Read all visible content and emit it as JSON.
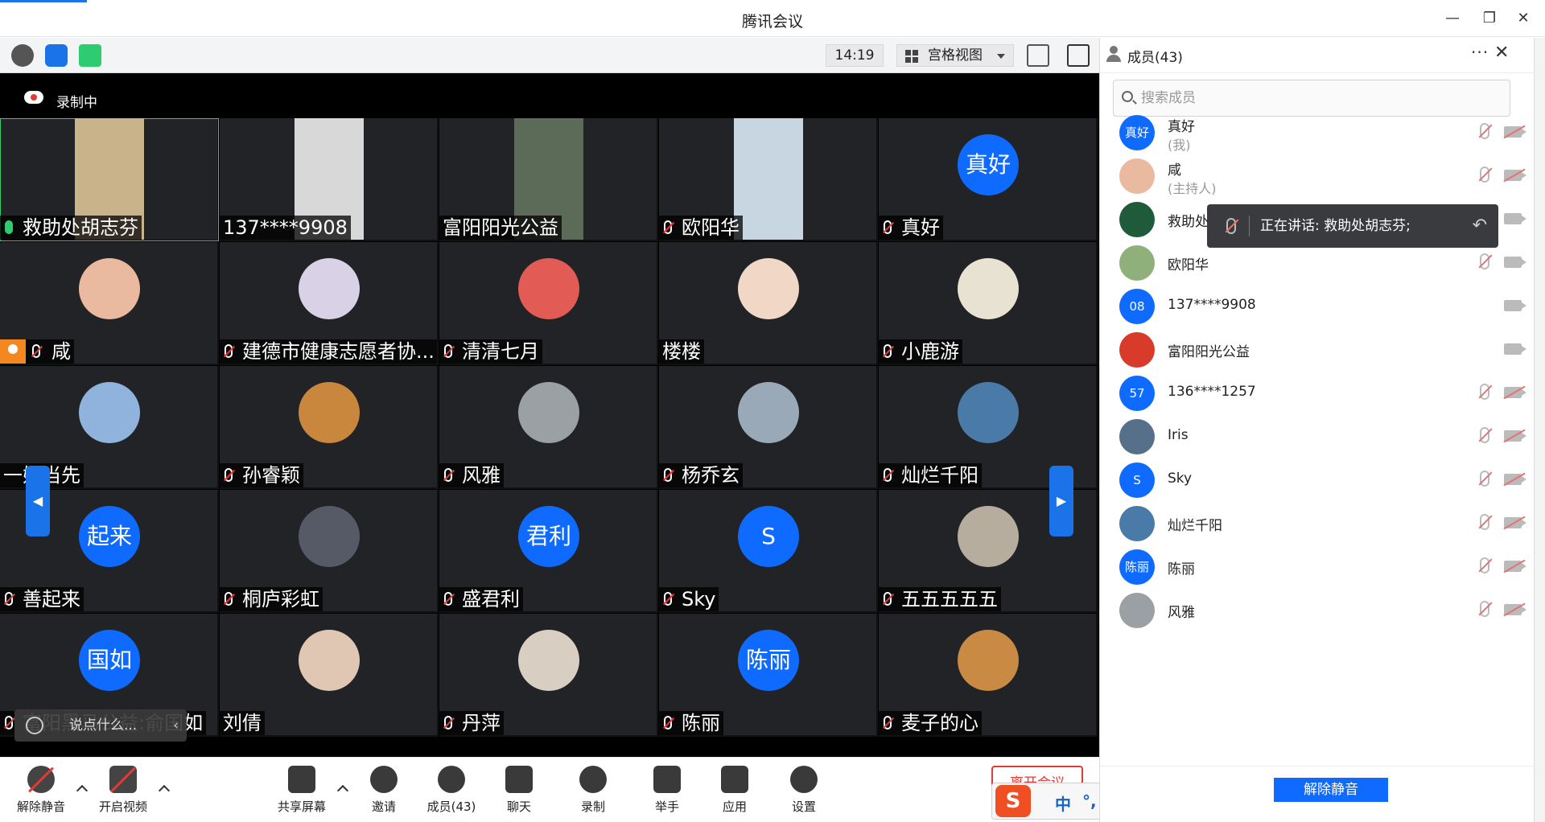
{
  "window": {
    "title": "腾讯会议"
  },
  "toolbar": {
    "time": "14:19",
    "view_mode": "宫格视图"
  },
  "recording": {
    "label": "录制中"
  },
  "tiles": [
    {
      "name": "救助处胡志芬",
      "mic": "on",
      "kind": "video",
      "color": "#c9b38b",
      "active": true
    },
    {
      "name": "137****9908",
      "mic": "none",
      "kind": "video",
      "color": "#d8d8d8"
    },
    {
      "name": "富阳阳光公益",
      "mic": "none",
      "kind": "video",
      "color": "#5c6a58"
    },
    {
      "name": "欧阳华",
      "mic": "muted",
      "kind": "video",
      "color": "#c8d6e2"
    },
    {
      "name": "真好",
      "mic": "muted",
      "kind": "initial",
      "initial": "真好"
    },
    {
      "name": "咸",
      "mic": "muted",
      "kind": "photo",
      "color": "#e9b9a0",
      "host": true
    },
    {
      "name": "建德市健康志愿者协...",
      "mic": "muted",
      "kind": "photo",
      "color": "#d9d2e6"
    },
    {
      "name": "清清七月",
      "mic": "muted",
      "kind": "photo",
      "color": "#e25b54"
    },
    {
      "name": "楼楼",
      "mic": "none",
      "kind": "photo",
      "color": "#f1d7c5"
    },
    {
      "name": "小鹿游",
      "mic": "muted",
      "kind": "photo",
      "color": "#e8e2d2"
    },
    {
      "name": "一妈当先",
      "mic": "none",
      "kind": "photo",
      "color": "#8fb3dc"
    },
    {
      "name": "孙睿颖",
      "mic": "muted",
      "kind": "photo",
      "color": "#c8873c"
    },
    {
      "name": "风雅",
      "mic": "muted",
      "kind": "photo",
      "color": "#9aa0a4"
    },
    {
      "name": "杨乔玄",
      "mic": "muted",
      "kind": "photo",
      "color": "#9aa9b7"
    },
    {
      "name": "灿烂千阳",
      "mic": "muted",
      "kind": "photo",
      "color": "#4a7aa8"
    },
    {
      "name": "善起来",
      "mic": "muted",
      "kind": "initial",
      "initial": "起来"
    },
    {
      "name": "桐庐彩虹",
      "mic": "muted",
      "kind": "photo",
      "color": "#555a66"
    },
    {
      "name": "盛君利",
      "mic": "muted",
      "kind": "initial",
      "initial": "君利"
    },
    {
      "name": "Sky",
      "mic": "muted",
      "kind": "initial",
      "initial": "S"
    },
    {
      "name": "五五五五五",
      "mic": "muted",
      "kind": "photo",
      "color": "#b7ad9f"
    },
    {
      "name": "富阳黑马公益:俞国如",
      "mic": "muted",
      "kind": "initial",
      "initial": "国如"
    },
    {
      "name": "刘倩",
      "mic": "none",
      "kind": "photo",
      "color": "#e0c7b4"
    },
    {
      "name": "丹萍",
      "mic": "muted",
      "kind": "photo",
      "color": "#d8cfc2"
    },
    {
      "name": "陈丽",
      "mic": "muted",
      "kind": "initial",
      "initial": "陈丽"
    },
    {
      "name": "麦子的心",
      "mic": "muted",
      "kind": "photo",
      "color": "#c98a43"
    }
  ],
  "chat_mini": {
    "placeholder": "说点什么..."
  },
  "bottombar": {
    "unmute": "解除静音",
    "start_video": "开启视频",
    "share_screen": "共享屏幕",
    "invite": "邀请",
    "members": "成员(43)",
    "chat": "聊天",
    "record": "录制",
    "raise_hand": "举手",
    "apps": "应用",
    "settings": "设置",
    "end_meeting": "离开会议"
  },
  "ime": {
    "logo": "S",
    "mode": "中",
    "punct": "°,"
  },
  "panel": {
    "title": "成员(43)",
    "search_placeholder": "搜索成员",
    "members": [
      {
        "name": "真好",
        "sub": "(我)",
        "avatar_text": "真好",
        "avatar_color": "#0f6bff",
        "mic": "muted",
        "cam": "off"
      },
      {
        "name": "咸",
        "sub": "(主持人)",
        "avatar_text": "",
        "avatar_color": "#e9b9a0",
        "mic": "muted",
        "cam": "off"
      },
      {
        "name": "救助处胡志芬",
        "sub": "",
        "avatar_text": "",
        "avatar_color": "#1f5a3a",
        "mic": "on",
        "cam": "on"
      },
      {
        "name": "欧阳华",
        "sub": "",
        "avatar_text": "",
        "avatar_color": "#8fb07a",
        "mic": "muted",
        "cam": "on"
      },
      {
        "name": "137****9908",
        "sub": "",
        "avatar_text": "08",
        "avatar_color": "#0f6bff",
        "mic": "none",
        "cam": "on"
      },
      {
        "name": "富阳阳光公益",
        "sub": "",
        "avatar_text": "",
        "avatar_color": "#d93b2b",
        "mic": "none",
        "cam": "on"
      },
      {
        "name": "136****1257",
        "sub": "",
        "avatar_text": "57",
        "avatar_color": "#0f6bff",
        "mic": "muted",
        "cam": "off"
      },
      {
        "name": "Iris",
        "sub": "",
        "avatar_text": "",
        "avatar_color": "#56708a",
        "mic": "muted",
        "cam": "off"
      },
      {
        "name": "Sky",
        "sub": "",
        "avatar_text": "S",
        "avatar_color": "#0f6bff",
        "mic": "muted",
        "cam": "off"
      },
      {
        "name": "灿烂千阳",
        "sub": "",
        "avatar_text": "",
        "avatar_color": "#4a7aa8",
        "mic": "muted",
        "cam": "off"
      },
      {
        "name": "陈丽",
        "sub": "",
        "avatar_text": "陈丽",
        "avatar_color": "#0f6bff",
        "mic": "muted",
        "cam": "off"
      },
      {
        "name": "风雅",
        "sub": "",
        "avatar_text": "",
        "avatar_color": "#9aa0a4",
        "mic": "muted",
        "cam": "off"
      }
    ],
    "speaking_label": "正在讲话: 救助处胡志芬;",
    "unmute_all": "解除静音"
  }
}
